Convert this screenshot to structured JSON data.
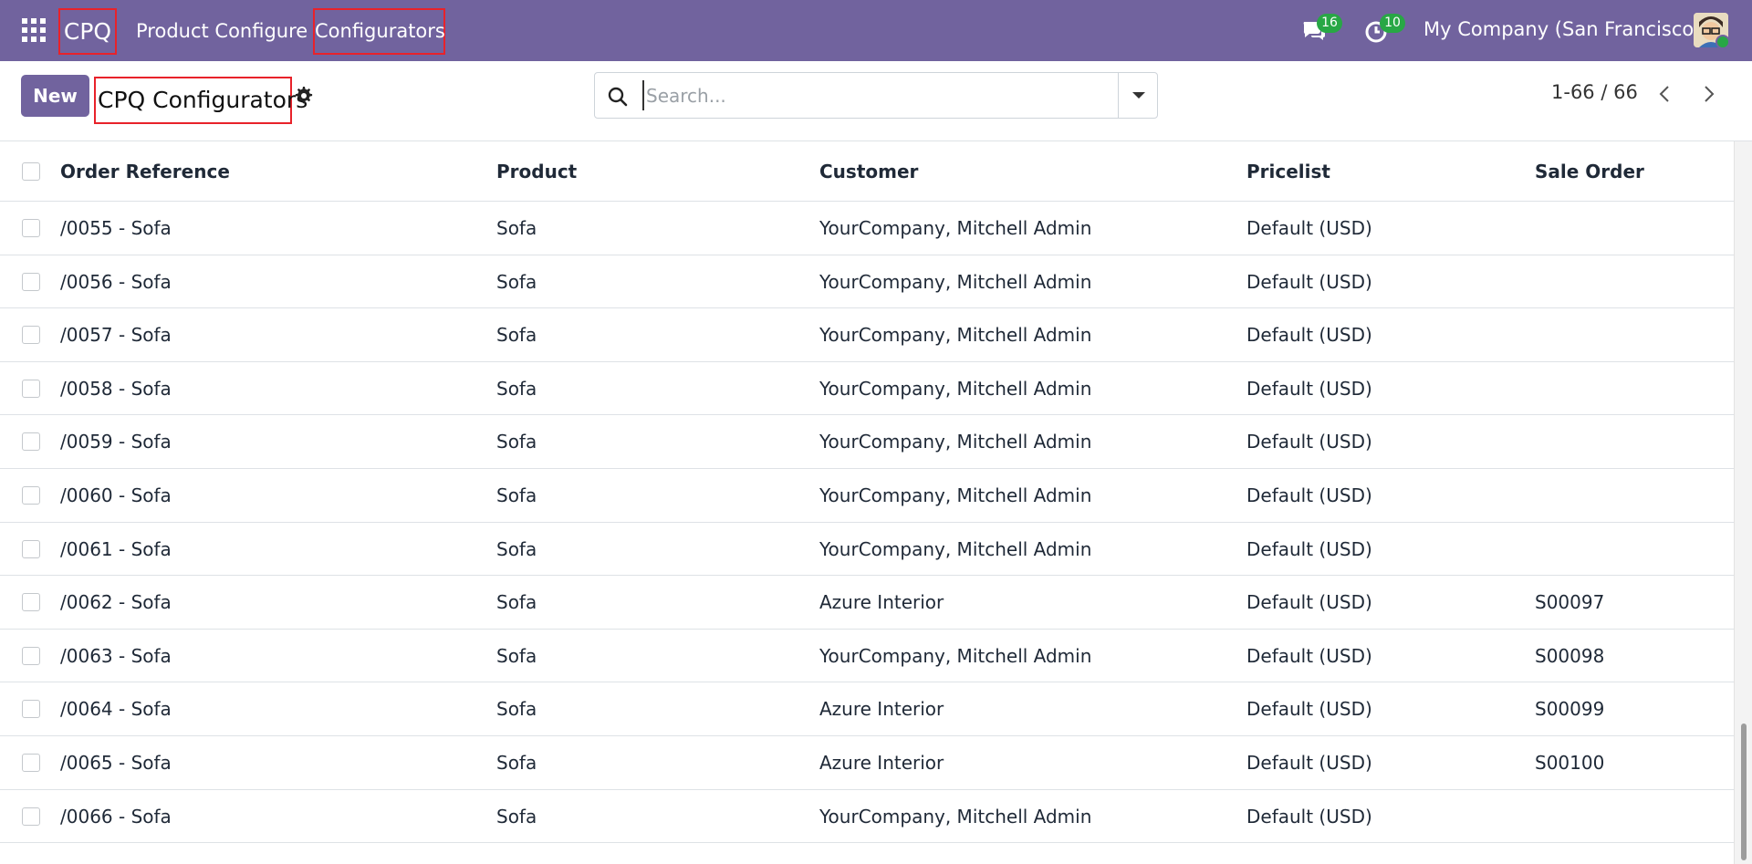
{
  "navbar": {
    "brand": "CPQ",
    "menu": [
      "Product Configure",
      "Configurators"
    ],
    "messages_count": "16",
    "activities_count": "10",
    "company": "My Company (San Francisco)"
  },
  "control_panel": {
    "new_label": "New",
    "title": "CPQ Configurators",
    "search_placeholder": "Search...",
    "pager": "1-66 / 66"
  },
  "columns": [
    "Order Reference",
    "Product",
    "Customer",
    "Pricelist",
    "Sale Order"
  ],
  "rows": [
    {
      "ref": "/0055 - Sofa",
      "product": "Sofa",
      "customer": "YourCompany, Mitchell Admin",
      "pricelist": "Default (USD)",
      "sale_order": ""
    },
    {
      "ref": "/0056 - Sofa",
      "product": "Sofa",
      "customer": "YourCompany, Mitchell Admin",
      "pricelist": "Default (USD)",
      "sale_order": ""
    },
    {
      "ref": "/0057 - Sofa",
      "product": "Sofa",
      "customer": "YourCompany, Mitchell Admin",
      "pricelist": "Default (USD)",
      "sale_order": ""
    },
    {
      "ref": "/0058 - Sofa",
      "product": "Sofa",
      "customer": "YourCompany, Mitchell Admin",
      "pricelist": "Default (USD)",
      "sale_order": ""
    },
    {
      "ref": "/0059 - Sofa",
      "product": "Sofa",
      "customer": "YourCompany, Mitchell Admin",
      "pricelist": "Default (USD)",
      "sale_order": ""
    },
    {
      "ref": "/0060 - Sofa",
      "product": "Sofa",
      "customer": "YourCompany, Mitchell Admin",
      "pricelist": "Default (USD)",
      "sale_order": ""
    },
    {
      "ref": "/0061 - Sofa",
      "product": "Sofa",
      "customer": "YourCompany, Mitchell Admin",
      "pricelist": "Default (USD)",
      "sale_order": ""
    },
    {
      "ref": "/0062 - Sofa",
      "product": "Sofa",
      "customer": "Azure Interior",
      "pricelist": "Default (USD)",
      "sale_order": "S00097"
    },
    {
      "ref": "/0063 - Sofa",
      "product": "Sofa",
      "customer": "YourCompany, Mitchell Admin",
      "pricelist": "Default (USD)",
      "sale_order": "S00098"
    },
    {
      "ref": "/0064 - Sofa",
      "product": "Sofa",
      "customer": "Azure Interior",
      "pricelist": "Default (USD)",
      "sale_order": "S00099"
    },
    {
      "ref": "/0065 - Sofa",
      "product": "Sofa",
      "customer": "Azure Interior",
      "pricelist": "Default (USD)",
      "sale_order": "S00100"
    },
    {
      "ref": "/0066 - Sofa",
      "product": "Sofa",
      "customer": "YourCompany, Mitchell Admin",
      "pricelist": "Default (USD)",
      "sale_order": ""
    }
  ],
  "colors": {
    "navbar": "#71639e",
    "primary": "#71639e",
    "badge": "#28a745",
    "highlight": "#e8222a"
  },
  "icons": [
    "apps-grid-icon",
    "chat-icon",
    "clock-icon",
    "gear-icon",
    "search-icon",
    "chevron-left-icon",
    "chevron-right-icon"
  ]
}
